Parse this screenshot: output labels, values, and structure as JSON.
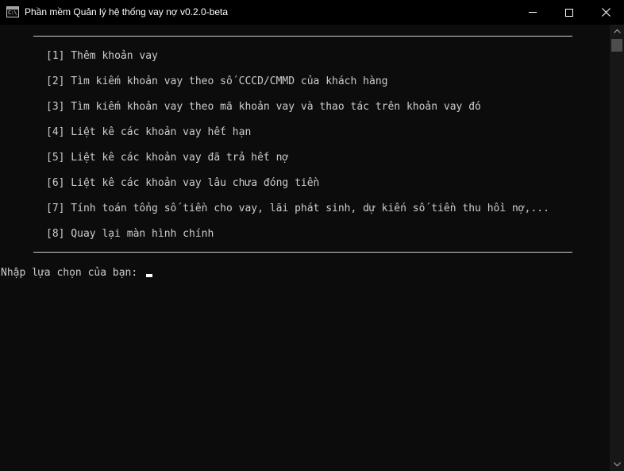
{
  "window": {
    "title": "Phần mềm Quản lý hệ thống vay nợ v0.2.0-beta",
    "icon_label": "C:\\"
  },
  "controls": {
    "minimize_icon": "minimize-icon",
    "maximize_icon": "maximize-icon",
    "close_icon": "close-icon"
  },
  "menu": {
    "items": [
      {
        "label": "[1] Thêm khoản vay"
      },
      {
        "label": "[2] Tìm kiếm khoản vay theo số CCCD/CMMD của khách hàng"
      },
      {
        "label": "[3] Tìm kiếm khoản vay theo mã khoản vay và thao tác trên khoản vay đó"
      },
      {
        "label": "[4] Liệt kê các khoản vay hết hạn"
      },
      {
        "label": "[5] Liệt kê các khoản vay đã trả hết nợ"
      },
      {
        "label": "[6] Liệt kê các khoản vay lâu chưa đóng tiền"
      },
      {
        "label": "[7] Tính toán tổng số tiền cho vay, lãi phát sinh, dự kiến số tiền thu hồi nợ,..."
      },
      {
        "label": "[8] Quay lại màn hình chính"
      }
    ]
  },
  "prompt": {
    "text": "Nhập lựa chọn của bạn: "
  },
  "colors": {
    "background": "#0c0c0c",
    "text": "#cccccc",
    "titlebar": "#000000"
  }
}
